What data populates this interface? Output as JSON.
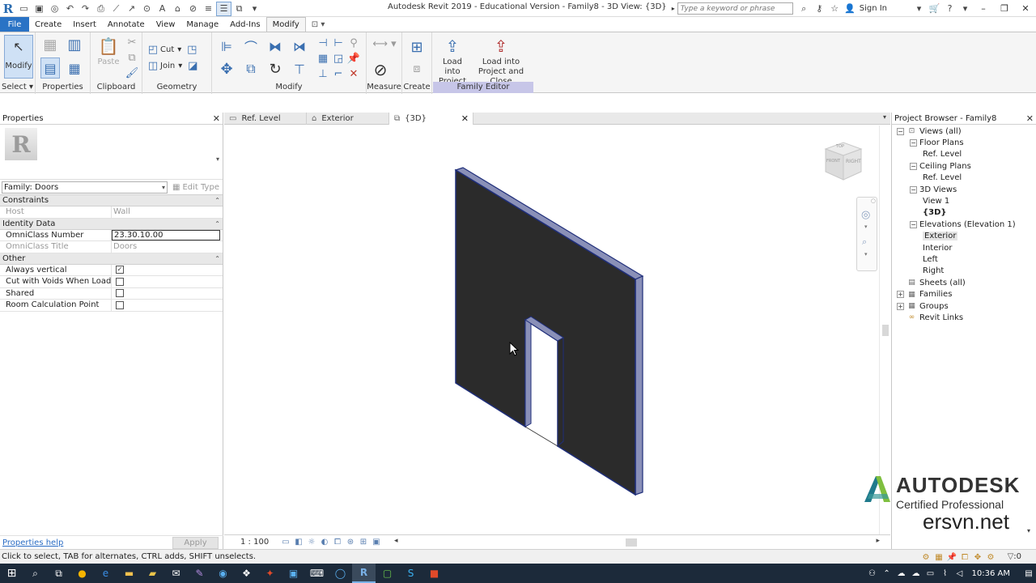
{
  "titlebar": {
    "title": "Autodesk Revit 2019 - Educational Version - Family8 - 3D View: {3D}",
    "search_placeholder": "Type a keyword or phrase",
    "sign_in": "Sign In"
  },
  "ribbon_tabs": [
    "File",
    "Create",
    "Insert",
    "Annotate",
    "View",
    "Manage",
    "Add-Ins",
    "Modify"
  ],
  "ribbon": {
    "modify": "Modify",
    "select": "Select",
    "properties": "Properties",
    "paste": "Paste",
    "cut": "Cut",
    "join": "Join",
    "clipboard": "Clipboard",
    "geometry": "Geometry",
    "modify_panel": "Modify",
    "measure": "Measure",
    "create": "Create",
    "load_project": "Load into Project",
    "load_close": "Load into Project and Close",
    "family_editor": "Family Editor"
  },
  "properties": {
    "header": "Properties",
    "family": "Family: Doors",
    "edit_type": "Edit Type",
    "groups": [
      {
        "name": "Constraints",
        "rows": [
          {
            "key": "Host",
            "value": "Wall",
            "readonly": true
          }
        ]
      },
      {
        "name": "Identity Data",
        "rows": [
          {
            "key": "OmniClass Number",
            "value": "23.30.10.00",
            "readonly": false
          },
          {
            "key": "OmniClass Title",
            "value": "Doors",
            "readonly": true
          }
        ]
      },
      {
        "name": "Other",
        "rows": [
          {
            "key": "Always vertical",
            "checked": true
          },
          {
            "key": "Cut with Voids When Loaded",
            "checked": false
          },
          {
            "key": "Shared",
            "checked": false
          },
          {
            "key": "Room Calculation Point",
            "checked": false
          }
        ]
      }
    ],
    "help": "Properties help",
    "apply": "Apply"
  },
  "view_tabs": [
    {
      "label": "Ref. Level",
      "active": false
    },
    {
      "label": "Exterior",
      "active": false
    },
    {
      "label": "{3D}",
      "active": true
    }
  ],
  "viewcube": {
    "front": "FRONT",
    "right": "RIGHT",
    "top": "TOP"
  },
  "viewbar": {
    "scale": "1 : 100"
  },
  "project_browser": {
    "header": "Project Browser - Family8",
    "tree": [
      {
        "label": "Views (all)",
        "level": 0,
        "toggle": "−",
        "icon": "views"
      },
      {
        "label": "Floor Plans",
        "level": 1,
        "toggle": "−"
      },
      {
        "label": "Ref. Level",
        "level": 2
      },
      {
        "label": "Ceiling Plans",
        "level": 1,
        "toggle": "−"
      },
      {
        "label": "Ref. Level",
        "level": 2
      },
      {
        "label": "3D Views",
        "level": 1,
        "toggle": "−"
      },
      {
        "label": "View 1",
        "level": 2
      },
      {
        "label": "{3D}",
        "level": 2,
        "bold": true
      },
      {
        "label": "Elevations (Elevation 1)",
        "level": 1,
        "toggle": "−"
      },
      {
        "label": "Exterior",
        "level": 2,
        "selected": true
      },
      {
        "label": "Interior",
        "level": 2
      },
      {
        "label": "Left",
        "level": 2
      },
      {
        "label": "Right",
        "level": 2
      },
      {
        "label": "Sheets (all)",
        "level": 0,
        "toggle": "",
        "icon": "sheets"
      },
      {
        "label": "Families",
        "level": 0,
        "toggle": "+",
        "icon": "families"
      },
      {
        "label": "Groups",
        "level": 0,
        "toggle": "+",
        "icon": "groups"
      },
      {
        "label": "Revit Links",
        "level": 0,
        "toggle": "",
        "icon": "links"
      }
    ]
  },
  "watermark": {
    "brand": "AUTODESK",
    "cert": "Certified Professional",
    "site": "ersvn.net"
  },
  "status": {
    "text": "Click to select, TAB for alternates, CTRL adds, SHIFT unselects.",
    "filter": ":0"
  },
  "taskbar": {
    "clock": "10:36 AM"
  },
  "colors": {
    "accent": "#2a73c5",
    "family_editor": "#c7c6e8",
    "wall_fill": "#2b2b2b",
    "wall_edge": "#8a90b8",
    "wall_outline": "#1f2e7a"
  }
}
